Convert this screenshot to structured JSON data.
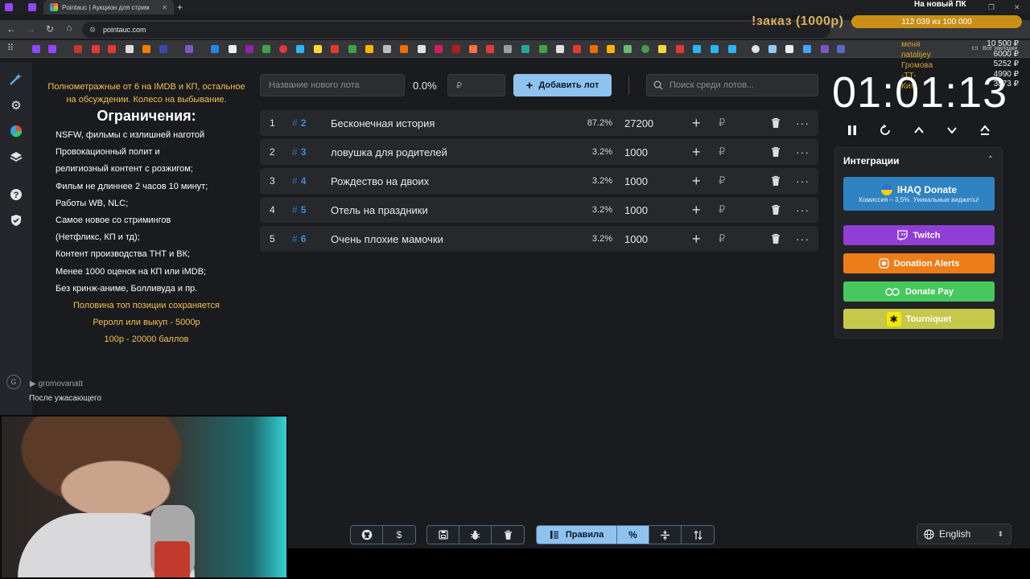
{
  "browser": {
    "tab_title": "Pointauc | Аукцион для стрим",
    "url": "pointauc.com",
    "bookmarks_label": "Все закладки"
  },
  "overlay": {
    "order_title": "!заказ (1000р)",
    "goal_label": "На новый ПК",
    "goal_progress": "112 039  из 100 000",
    "top_donors": [
      "меня",
      "natalijey",
      "Громова",
      "-TT-",
      "Кит"
    ],
    "top_amounts": [
      "10 500 ₽",
      "6000 ₽",
      "5252 ₽",
      "4990 ₽",
      "3873 ₽"
    ]
  },
  "sidebar": {
    "icons": [
      "wand-icon",
      "gear-icon",
      "pie-chart-icon",
      "layers-icon",
      "help-icon",
      "shield-icon"
    ]
  },
  "rules": {
    "top": "Полнометражные от 6 на IMDB и КП, остальное на обсуждении. Колесо на выбывание.",
    "heading": "Ограничения:",
    "items": [
      "NSFW, фильмы с излишней наготой",
      "Провокационный полит и",
      "религиозный контент с розжигом;",
      "Фильм не длиннее 2 часов 10 минут;",
      "Работы WB, NLC;",
      "Самое новое со стримингов",
      "(Нетфликс, КП и тд);",
      "Контент производства ТНТ и ВК;",
      "Менее 1000 оценок на КП или iMDB;",
      "Без кринж-аниме, Болливуда и пр."
    ],
    "bottom": [
      "Половина топ позиции сохраняется",
      "Реролл или выкуп - 5000р",
      "100р - 20000 баллов"
    ]
  },
  "chat": {
    "avatar_letter": "G",
    "username": "gromovanatt",
    "message": "После ужасающего"
  },
  "controls": {
    "lot_name_placeholder": "Название нового лота",
    "percent": "0.0%",
    "amount_placeholder": "₽",
    "add_lot_label": "Добавить лот",
    "search_placeholder": "Поиск среди лотов..."
  },
  "lots": [
    {
      "index": "1",
      "id": "2",
      "name": "Бесконечная история",
      "percent": "87.2%",
      "amount": "27200"
    },
    {
      "index": "2",
      "id": "3",
      "name": "ловушка для родителей",
      "percent": "3.2%",
      "amount": "1000"
    },
    {
      "index": "3",
      "id": "4",
      "name": "Рождество на двоих",
      "percent": "3.2%",
      "amount": "1000"
    },
    {
      "index": "4",
      "id": "5",
      "name": "Отель на праздники",
      "percent": "3.2%",
      "amount": "1000"
    },
    {
      "index": "5",
      "id": "6",
      "name": "Очень плохие мамочки",
      "percent": "3.2%",
      "amount": "1000"
    }
  ],
  "lot_symbols": {
    "plus": "+",
    "rub": "₽",
    "more": "···",
    "hash": "#"
  },
  "timer": {
    "value": "01:01:13",
    "controls": [
      "pause-icon",
      "restart-icon",
      "chevron-up-icon",
      "chevron-down-icon",
      "eject-icon"
    ]
  },
  "integrations": {
    "title": "Интеграции",
    "ihaq": {
      "label": "IHAQ Donate",
      "sub": "Комиссия – 3,5%. Уникальные виджеты!"
    },
    "twitch": "Twitch",
    "donation_alerts": "Donation Alerts",
    "donate_pay": "Donate Pay",
    "tourniquet": "Tourniquet"
  },
  "toolbar": {
    "rules_label": "Правила",
    "percent_label": "%"
  },
  "language": {
    "selected": "English"
  },
  "colors": {
    "accent": "#8ec3f0",
    "lot_id": "#3d8bd8",
    "rules_highlight": "#f2c14e",
    "twitch": "#8f3ed6",
    "donation_alerts": "#ed7d18",
    "donate_pay": "#46c85c",
    "tourniquet": "#c5c84a",
    "ihaq": "#2f83c3"
  }
}
